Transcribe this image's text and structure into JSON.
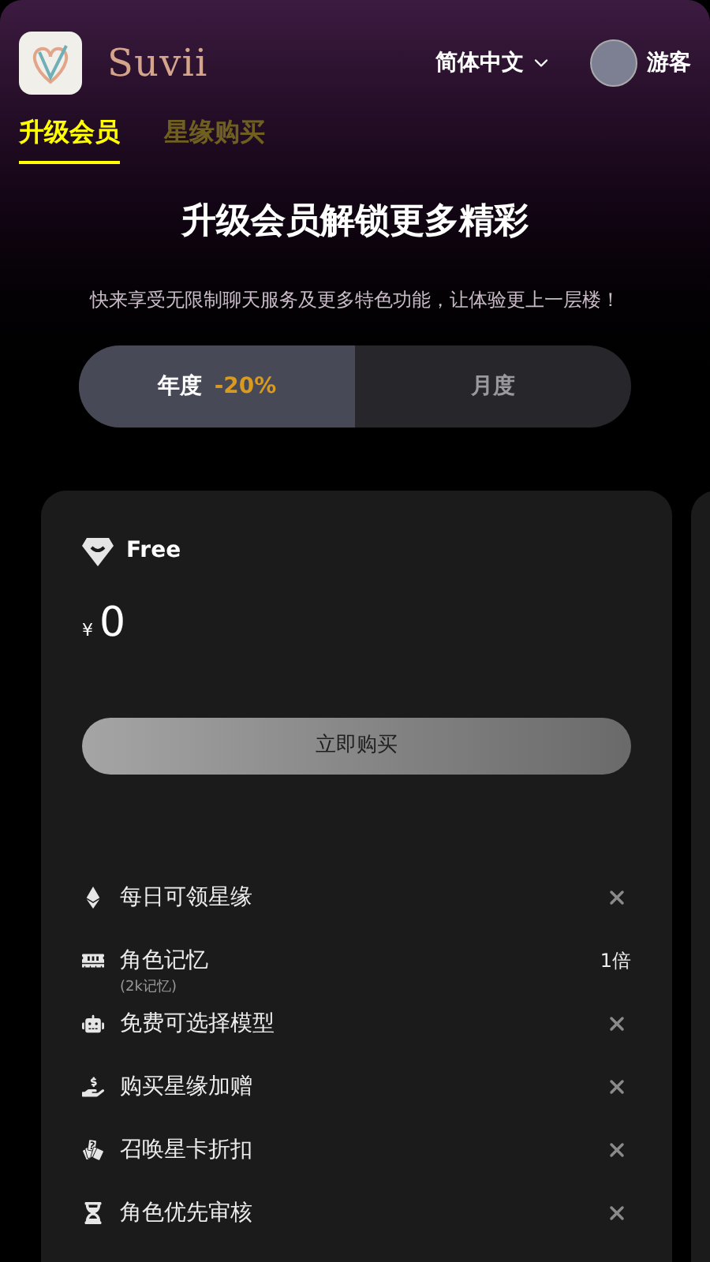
{
  "header": {
    "brand": "Suvii",
    "language": "简体中文",
    "user": "游客"
  },
  "tabs": [
    {
      "label": "升级会员",
      "selected": true
    },
    {
      "label": "星缘购买",
      "selected": false
    }
  ],
  "title": "升级会员解锁更多精彩",
  "subtitle": "快来享受无限制聊天服务及更多特色功能，让体验更上一层楼！",
  "billing": [
    {
      "label": "年度",
      "badge": "-20%",
      "selected": true
    },
    {
      "label": "月度",
      "selected": false
    }
  ],
  "plan": {
    "name": "Free",
    "currency": "¥",
    "price": "0",
    "button": "立即购买",
    "features": [
      {
        "label": "每日可领星缘",
        "kind": "cross"
      },
      {
        "label": "角色记忆",
        "note": "(2k记忆)",
        "kind": "value",
        "value": "1倍"
      },
      {
        "label": "免费可选择模型",
        "kind": "cross"
      },
      {
        "label": "购买星缘加赠",
        "kind": "cross"
      },
      {
        "label": "召唤星卡折扣",
        "kind": "cross"
      },
      {
        "label": "角色优先审核",
        "kind": "cross"
      }
    ]
  }
}
